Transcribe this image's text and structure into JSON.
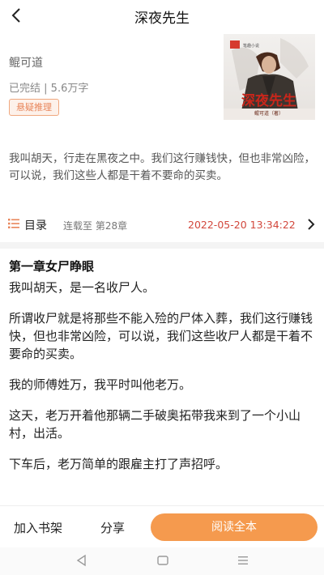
{
  "header": {
    "title": "深夜先生"
  },
  "book": {
    "author": "鲲可道",
    "status": "已完结",
    "word_count": "5.6万字",
    "tag": "悬疑推理",
    "cover_title": "深夜先生",
    "cover_subtitle": "鲲可道（著）",
    "cover_badge": "笔趣小说"
  },
  "intro": "我叫胡天，行走在黑夜之中。我们这行赚钱快，但也非常凶险，可以说，我们这些人都是干着不要命的买卖。",
  "catalog": {
    "label": "目录",
    "status": "连载至 第28章",
    "updated": "2022-05-20 13:34:22"
  },
  "chapter": {
    "title": "第一章女尸睁眼",
    "paragraphs": [
      "我叫胡天，是一名收尸人。",
      "所谓收尸就是将那些不能入殓的尸体入葬，我们这行赚钱快，但也非常凶险，可以说，我们这些收尸人都是干着不要命的买卖。",
      "我的师傅姓万，我平时叫他老万。",
      "这天，老万开着他那辆二手破奥拓带我来到了一个小山村，出活。",
      "下车后，老万简单的跟雇主打了声招呼。"
    ]
  },
  "actions": {
    "add_shelf": "加入书架",
    "share": "分享",
    "read_all": "阅读全本"
  },
  "colors": {
    "accent": "#f59a4e",
    "time": "#d2473c",
    "tag": "#e8855a"
  }
}
